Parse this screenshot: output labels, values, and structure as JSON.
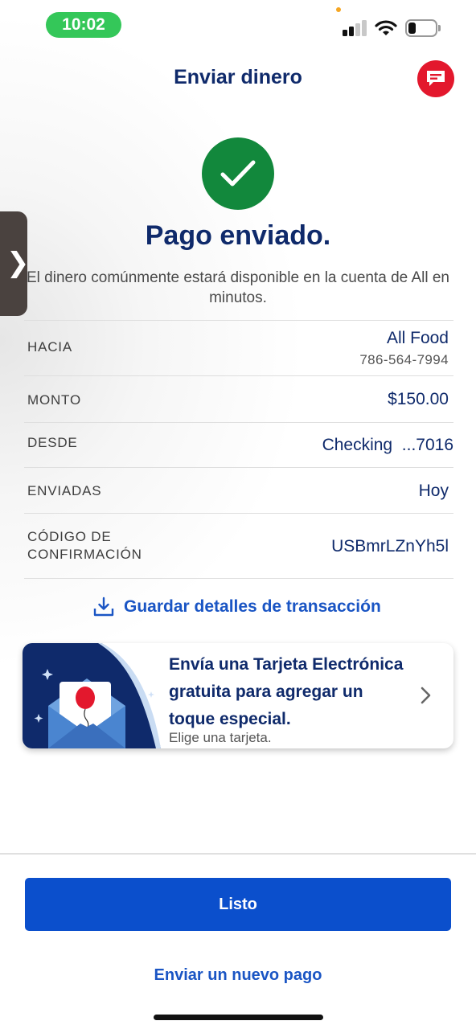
{
  "status_bar": {
    "time": "10:02",
    "time_pill_color": "#34c759",
    "icons": [
      "signal-icon",
      "wifi-icon",
      "battery-icon"
    ]
  },
  "header": {
    "title": "Enviar dinero",
    "chat_icon": "chat-icon",
    "chat_color": "#e3182d"
  },
  "side_tab": {
    "glyph": "❯"
  },
  "success": {
    "icon": "checkmark-icon",
    "icon_color": "#12883c",
    "title": "Pago enviado.",
    "subtitle": "El dinero comúnmente estará disponible en la cuenta de All en minutos."
  },
  "details": {
    "to": {
      "label": "HACIA",
      "name": "All Food",
      "phone": "786-564-7994"
    },
    "amount": {
      "label": "MONTO",
      "value": "$150.00"
    },
    "from": {
      "label": "DESDE",
      "value": "Checking  ...7016"
    },
    "sent": {
      "label": "ENVIADAS",
      "value": "Hoy"
    },
    "confirmation": {
      "label_line1": "CÓDIGO DE",
      "label_line2": "CONFIRMACIÓN",
      "value": "USBmrLZnYh5l"
    }
  },
  "save_details": {
    "label": "Guardar detalles de transacción",
    "icon": "download-icon"
  },
  "ecard": {
    "title": "Envía una Tarjeta Electrónica gratuita para agregar un toque especial.",
    "subtitle": "Elige una tarjeta.",
    "illustration": "envelope-balloon-illustration",
    "chevron": "chevron-right-icon"
  },
  "footer": {
    "done_label": "Listo",
    "new_payment_label": "Enviar un nuevo pago",
    "accent_color": "#0b4fcc"
  }
}
